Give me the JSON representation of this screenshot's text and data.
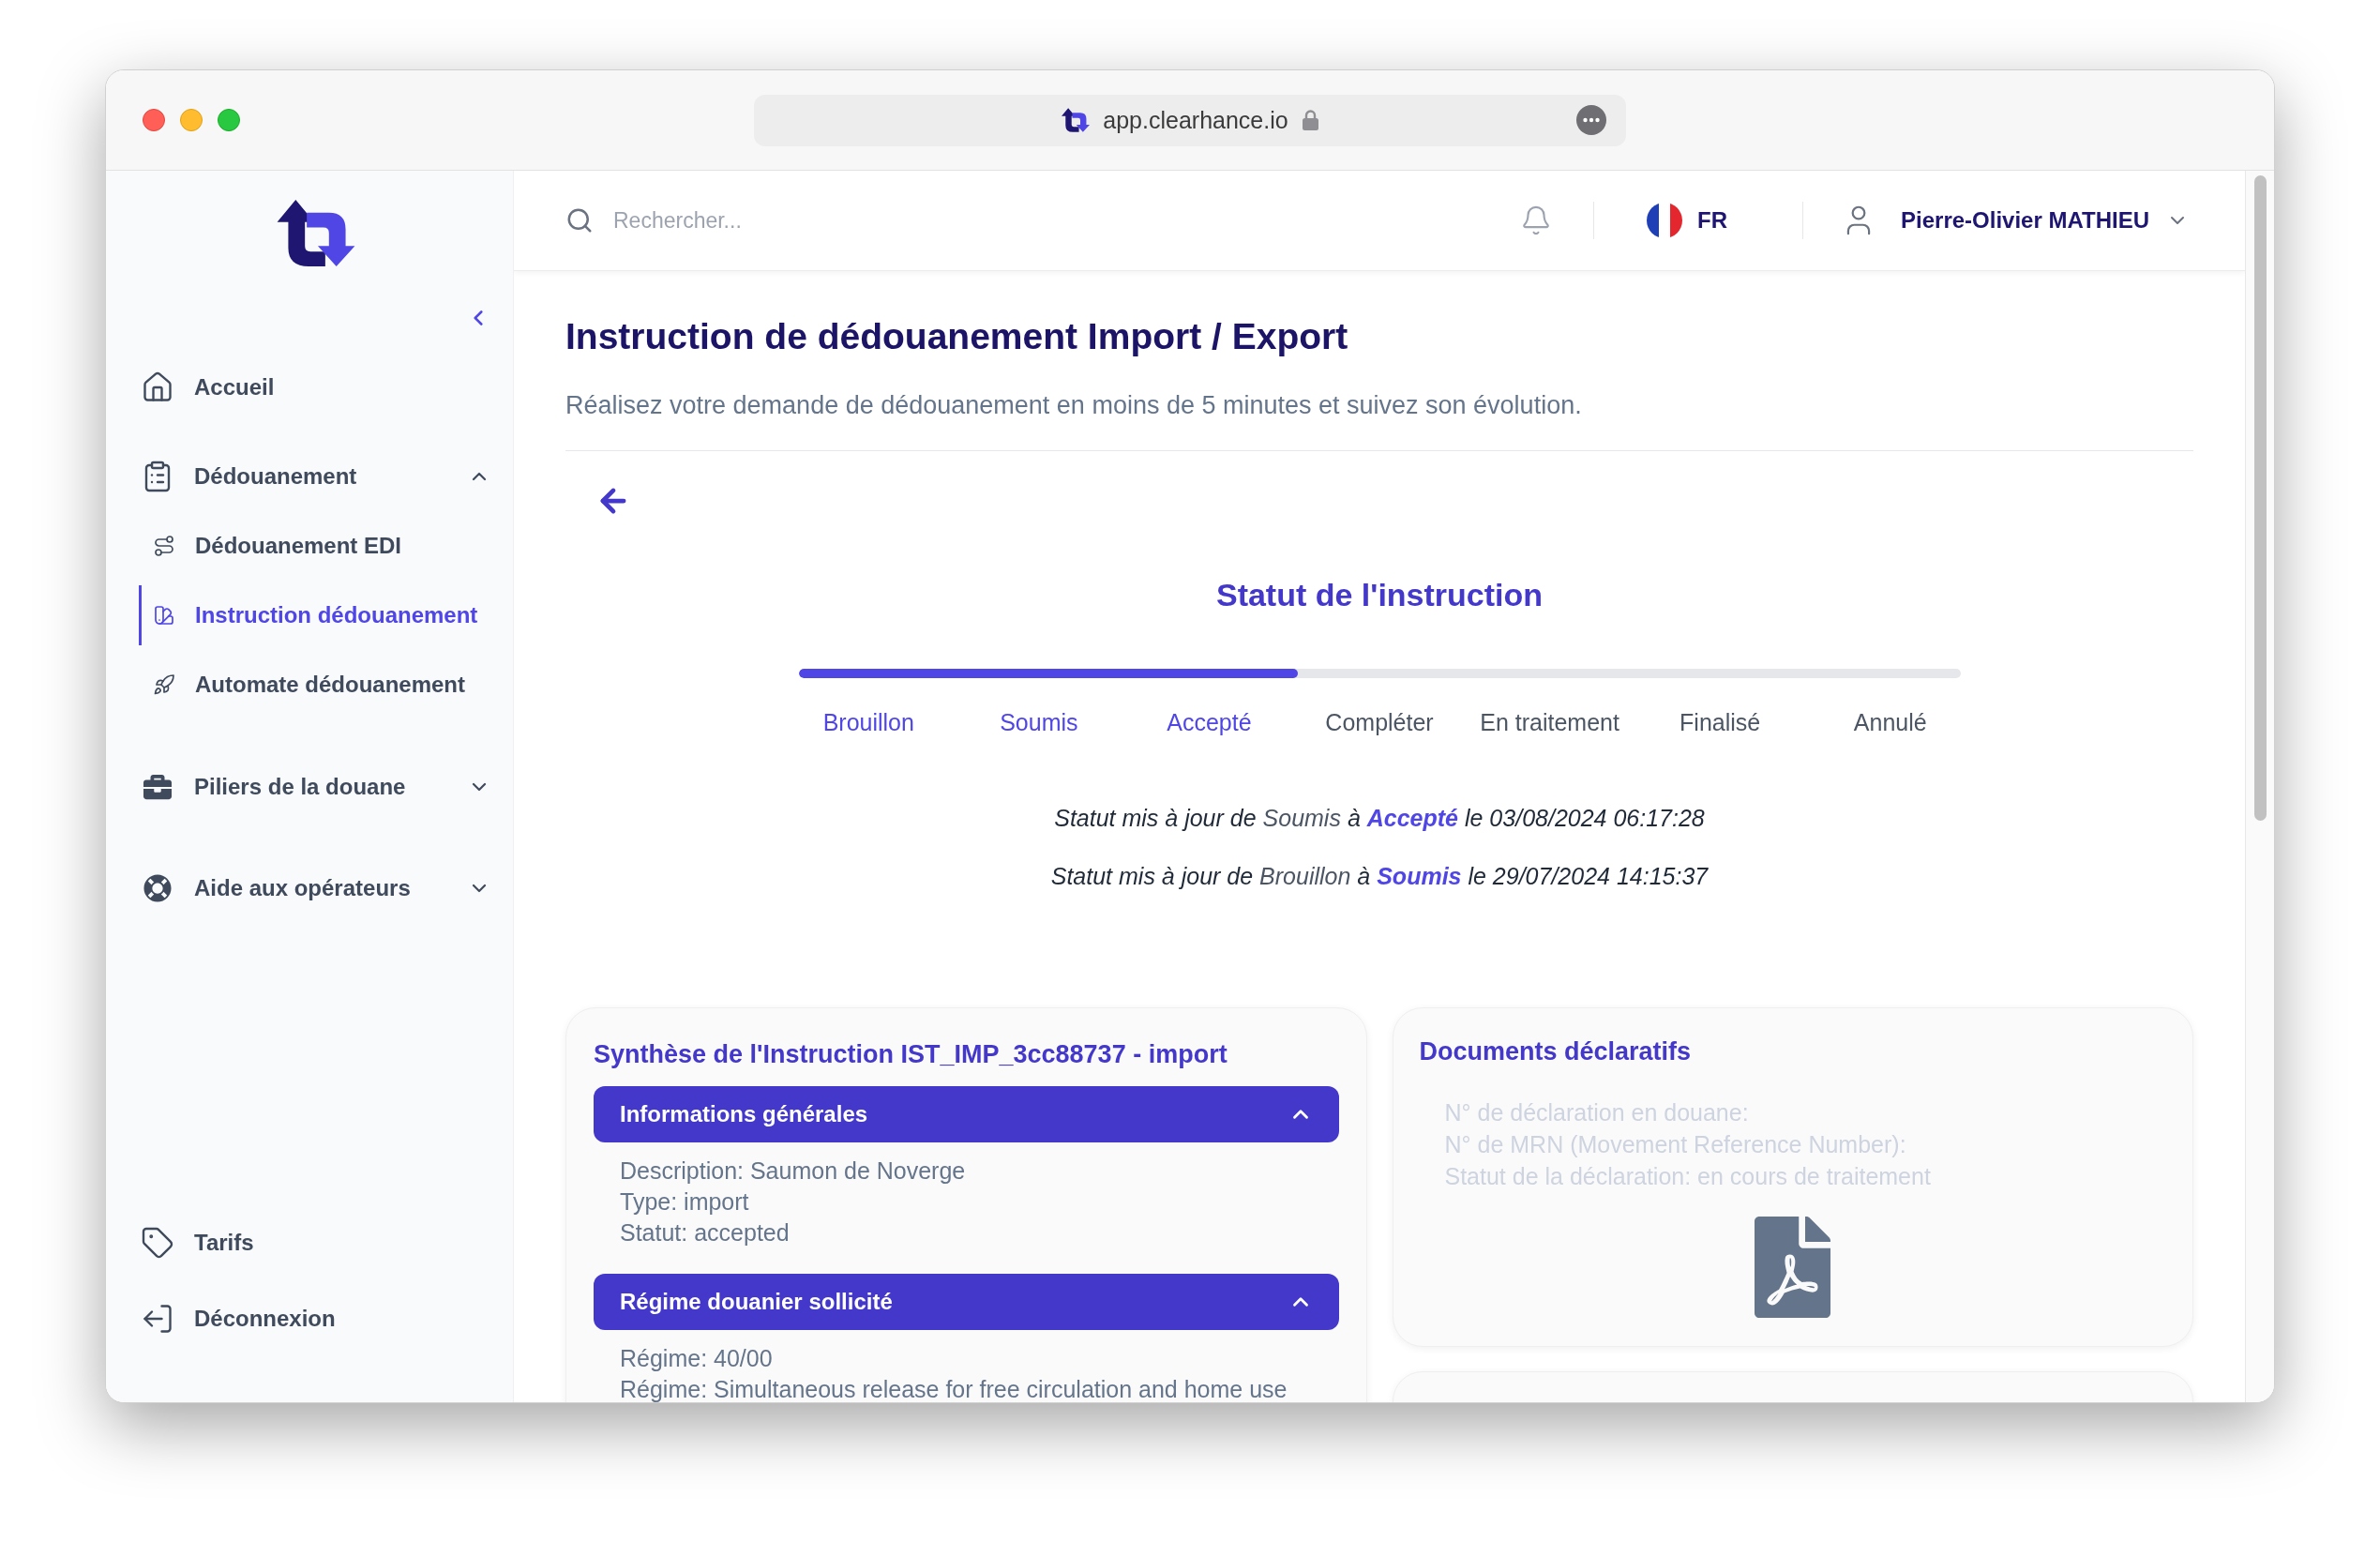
{
  "browser": {
    "url": "app.clearhance.io"
  },
  "sidebar": {
    "items": [
      {
        "label": "Accueil",
        "selected": false
      },
      {
        "label": "Dédouanement",
        "selected": false,
        "expanded": true,
        "children": [
          {
            "label": "Dédouanement EDI",
            "selected": false
          },
          {
            "label": "Instruction dédouanement",
            "selected": true
          },
          {
            "label": "Automate dédouanement",
            "selected": false
          }
        ]
      },
      {
        "label": "Piliers de la douane",
        "selected": false,
        "expanded": false
      },
      {
        "label": "Aide aux opérateurs",
        "selected": false,
        "expanded": false
      }
    ],
    "bottom_items": [
      {
        "label": "Tarifs",
        "selected": false
      },
      {
        "label": "Déconnexion",
        "selected": false
      }
    ]
  },
  "header": {
    "search": {
      "placeholder": "Rechercher..."
    },
    "language": "FR",
    "user": "Pierre-Olivier MATHIEU"
  },
  "page": {
    "title": "Instruction de dédouanement Import / Export",
    "subtitle": "Réalisez votre demande de dédouanement en moins de 5 minutes et suivez son évolution."
  },
  "status": {
    "title": "Statut de l'instruction",
    "progress": {
      "level": 0.43
    },
    "steps": [
      {
        "label": "Brouillon",
        "completed": true
      },
      {
        "label": "Soumis",
        "completed": true
      },
      {
        "label": "Accepté",
        "completed": true
      },
      {
        "label": "Compléter",
        "completed": false
      },
      {
        "label": "En traitement",
        "completed": false
      },
      {
        "label": "Finalisé",
        "completed": false
      },
      {
        "label": "Annulé",
        "completed": false
      }
    ],
    "history": [
      {
        "prefix": "Statut mis à jour de",
        "from": "Soumis",
        "connector": "à",
        "to": "Accepté",
        "suffix": "le 03/08/2024 06:17:28"
      },
      {
        "prefix": "Statut mis à jour de",
        "from": "Brouillon",
        "connector": "à",
        "to": "Soumis",
        "suffix": "le 29/07/2024 14:15:37"
      }
    ]
  },
  "summary_card": {
    "title": "Synthèse de l'Instruction IST_IMP_3cc88737 - import",
    "sections": [
      {
        "title": "Informations générales",
        "expanded": true,
        "lines": [
          "Description: Saumon de Noverge",
          "Type: import",
          "Statut: accepted"
        ]
      },
      {
        "title": "Régime douanier sollicité",
        "expanded": true,
        "lines": [
          "Régime: 40/00",
          "Régime: Simultaneous release for free circulation and home use"
        ]
      }
    ]
  },
  "documents_card": {
    "title": "Documents déclaratifs",
    "disabled": true,
    "lines": [
      "N° de déclaration en douane:",
      "N° de MRN (Movement Reference Number):",
      "Statut de la déclaration: en cours de traitement"
    ]
  }
}
